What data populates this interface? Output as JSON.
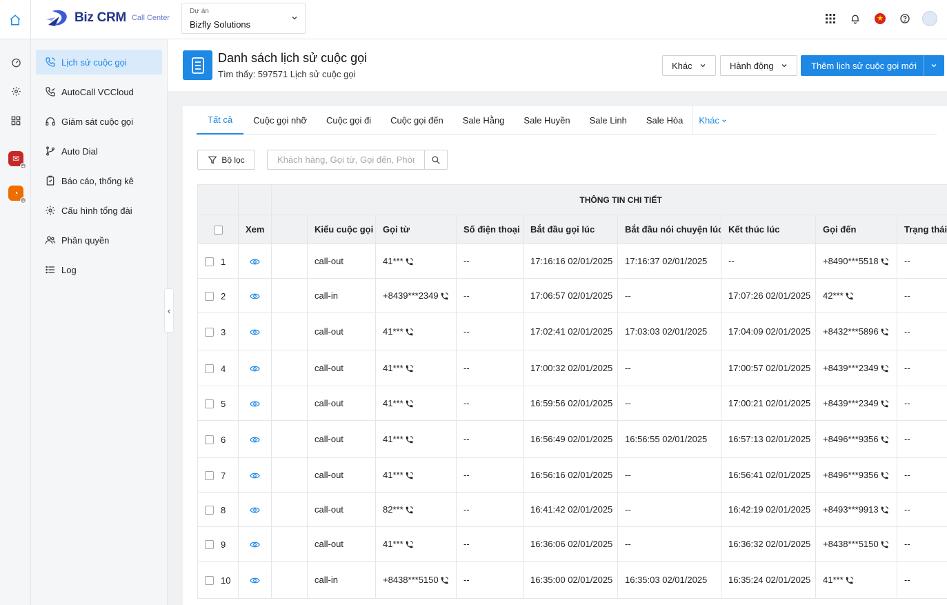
{
  "brand": {
    "name": "Biz CRM",
    "sub": "Call Center"
  },
  "project": {
    "label": "Dự án",
    "value": "Bizfly Solutions"
  },
  "sidebar": {
    "items": [
      {
        "label": "Lịch sử cuộc gọi",
        "icon": "phone-history-icon",
        "active": true
      },
      {
        "label": "AutoCall VCCloud",
        "icon": "phone-auto-icon"
      },
      {
        "label": "Giám sát cuộc gọi",
        "icon": "headset-icon"
      },
      {
        "label": "Auto Dial",
        "icon": "branch-icon"
      },
      {
        "label": "Báo cáo, thống kê",
        "icon": "report-icon"
      },
      {
        "label": "Cấu hình tổng đài",
        "icon": "gear-icon"
      },
      {
        "label": "Phân quyền",
        "icon": "users-icon"
      },
      {
        "label": "Log",
        "icon": "list-icon"
      }
    ]
  },
  "header": {
    "title": "Danh sách lịch sử cuộc gọi",
    "subtitle": "Tìm thấy: 597571 Lịch sử cuộc gọi",
    "btn_other": "Khác",
    "btn_action": "Hành động",
    "btn_add": "Thêm lịch sử cuộc gọi mới"
  },
  "tabs": [
    "Tất cả",
    "Cuộc gọi nhỡ",
    "Cuộc gọi đi",
    "Cuộc gọi đến",
    "Sale Hằng",
    "Sale Huyền",
    "Sale Linh",
    "Sale Hòa"
  ],
  "tab_more": "Khác",
  "filter": {
    "label": "Bộ lọc",
    "placeholder": "Khách hàng, Gọi từ, Gọi đến, Phòng"
  },
  "table": {
    "group_header": "THÔNG TIN CHI TIẾT",
    "columns": [
      "Xem",
      "Kiểu cuộc gọi",
      "Gọi từ",
      "Số điện thoại",
      "Bắt đầu gọi lúc",
      "Bắt đầu nói chuyện lúc",
      "Kết thúc lúc",
      "Gọi đến",
      "Trạng thái cuộc gọi"
    ],
    "rows": [
      {
        "no": "1",
        "type": "call-out",
        "from": "41***",
        "phone": "--",
        "start": "17:16:16 02/01/2025",
        "talk": "17:16:37 02/01/2025",
        "end": "--",
        "to": "+8490***5518",
        "status": "--"
      },
      {
        "no": "2",
        "type": "call-in",
        "from": "+8439***2349",
        "phone": "--",
        "start": "17:06:57 02/01/2025",
        "talk": "--",
        "end": "17:07:26 02/01/2025",
        "to": "42***",
        "status": "--"
      },
      {
        "no": "3",
        "type": "call-out",
        "from": "41***",
        "phone": "--",
        "start": "17:02:41 02/01/2025",
        "talk": "17:03:03 02/01/2025",
        "end": "17:04:09 02/01/2025",
        "to": "+8432***5896",
        "status": "--"
      },
      {
        "no": "4",
        "type": "call-out",
        "from": "41***",
        "phone": "--",
        "start": "17:00:32 02/01/2025",
        "talk": "--",
        "end": "17:00:57 02/01/2025",
        "to": "+8439***2349",
        "status": "--"
      },
      {
        "no": "5",
        "type": "call-out",
        "from": "41***",
        "phone": "--",
        "start": "16:59:56 02/01/2025",
        "talk": "--",
        "end": "17:00:21 02/01/2025",
        "to": "+8439***2349",
        "status": "--"
      },
      {
        "no": "6",
        "type": "call-out",
        "from": "41***",
        "phone": "--",
        "start": "16:56:49 02/01/2025",
        "talk": "16:56:55 02/01/2025",
        "end": "16:57:13 02/01/2025",
        "to": "+8496***9356",
        "status": "--"
      },
      {
        "no": "7",
        "type": "call-out",
        "from": "41***",
        "phone": "--",
        "start": "16:56:16 02/01/2025",
        "talk": "--",
        "end": "16:56:41 02/01/2025",
        "to": "+8496***9356",
        "status": "--"
      },
      {
        "no": "8",
        "type": "call-out",
        "from": "82***",
        "phone": "--",
        "start": "16:41:42 02/01/2025",
        "talk": "--",
        "end": "16:42:19 02/01/2025",
        "to": "+8493***9913",
        "status": "--"
      },
      {
        "no": "9",
        "type": "call-out",
        "from": "41***",
        "phone": "--",
        "start": "16:36:06 02/01/2025",
        "talk": "--",
        "end": "16:36:32 02/01/2025",
        "to": "+8438***5150",
        "status": "--"
      },
      {
        "no": "10",
        "type": "call-in",
        "from": "+8438***5150",
        "phone": "--",
        "start": "16:35:00 02/01/2025",
        "talk": "16:35:03 02/01/2025",
        "end": "16:35:24 02/01/2025",
        "to": "41***",
        "status": "--"
      }
    ]
  },
  "colors": {
    "accent": "#1e88e5",
    "brand": "#23358a"
  }
}
